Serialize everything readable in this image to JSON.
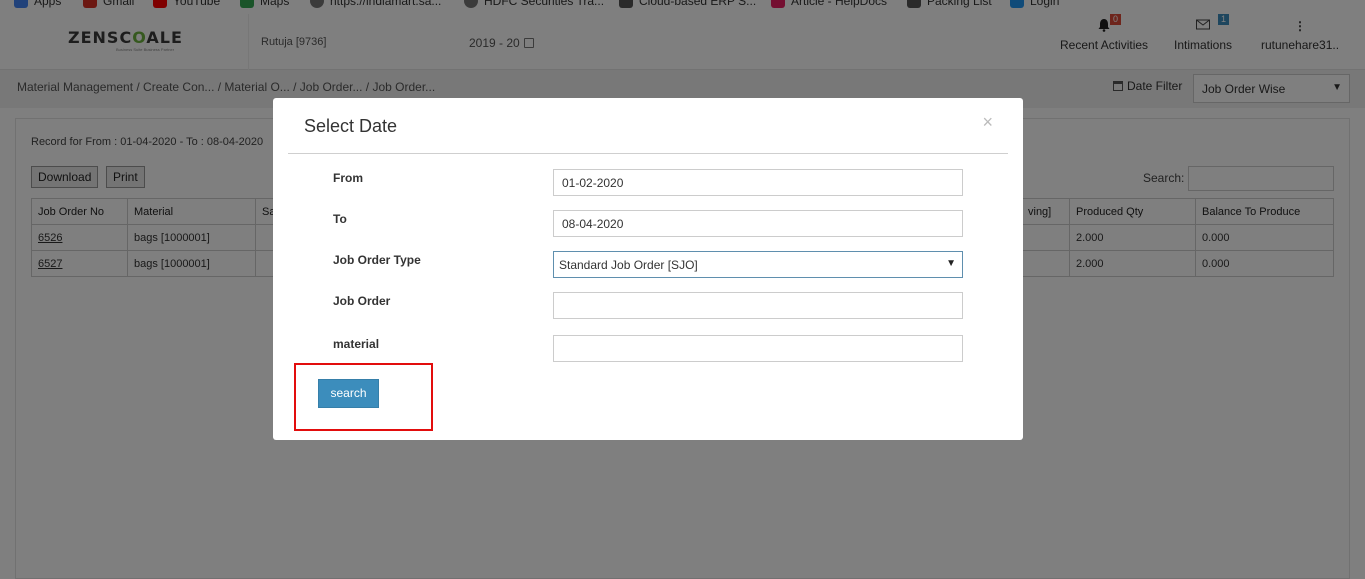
{
  "bookmarks": [
    {
      "label": "Apps",
      "icon": "apps-grid-icon",
      "color": "#4285f4"
    },
    {
      "label": "Gmail",
      "icon": "gmail-icon",
      "color": "#d93025"
    },
    {
      "label": "YouTube",
      "icon": "youtube-icon",
      "color": "#ff0000"
    },
    {
      "label": "Maps",
      "icon": "maps-icon",
      "color": "#34a853"
    },
    {
      "label": "https://indiamart.sa...",
      "icon": "globe-icon",
      "color": "#777777"
    },
    {
      "label": "HDFC Securities Tra...",
      "icon": "globe-icon",
      "color": "#777777"
    },
    {
      "label": "Cloud-based ERP S...",
      "icon": "cloud-icon",
      "color": "#555555"
    },
    {
      "label": "Article - HelpDocs",
      "icon": "helpdocs-icon",
      "color": "#e91e63"
    },
    {
      "label": "Packing List",
      "icon": "list-icon",
      "color": "#555555"
    },
    {
      "label": "Login",
      "icon": "login-icon",
      "color": "#2196f3"
    }
  ],
  "header": {
    "logo_left": "ZENSC",
    "logo_accent": "O",
    "logo_right": "ALE",
    "logo_tagline": "Business Suite Business Partner",
    "user": "Rutuja [9736]",
    "year": "2019 - 20",
    "recent_activities": {
      "label": "Recent Activities",
      "badge": "0",
      "badge_color": "#dd4b39"
    },
    "intimations": {
      "label": "Intimations",
      "badge": "1",
      "badge_color": "#3c8dbc"
    },
    "account": {
      "label": "rutunehare31.."
    }
  },
  "breadcrumb": "Material Management  / Create Con... / Material O... / Job Order... / Job Order...",
  "date_filter": {
    "label": "Date Filter",
    "value": "Job Order Wise"
  },
  "record_text": "Record for From : 01-04-2020 - To : 08-04-2020",
  "toolbar": {
    "download": "Download",
    "print": "Print",
    "search_label": "Search:"
  },
  "table": {
    "headers": [
      "Job Order No",
      "Material",
      "Sa",
      "",
      "ving]",
      "Produced Qty",
      "Balance To Produce"
    ],
    "rows": [
      [
        "6526",
        "bags [1000001]",
        "",
        "",
        "",
        "2.000",
        "0.000"
      ],
      [
        "6527",
        "bags [1000001]",
        "",
        "",
        "",
        "2.000",
        "0.000"
      ]
    ]
  },
  "modal": {
    "title": "Select Date",
    "close": "×",
    "fields": {
      "from": {
        "label": "From",
        "value": "01-02-2020"
      },
      "to": {
        "label": "To",
        "value": "08-04-2020"
      },
      "job_order_type": {
        "label": "Job Order Type",
        "value": "Standard Job Order [SJO]"
      },
      "job_order": {
        "label": "Job Order",
        "value": ""
      },
      "material": {
        "label": "material",
        "value": ""
      }
    },
    "search_button": "search"
  }
}
